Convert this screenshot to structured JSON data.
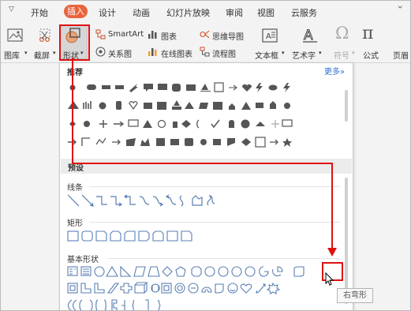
{
  "menu": {
    "tabs": [
      "开始",
      "插入",
      "设计",
      "动画",
      "幻灯片放映",
      "审阅",
      "视图",
      "云服务"
    ],
    "active_index": 1
  },
  "ribbon": {
    "gallery_label": "图库",
    "screenshot_label": "截屏",
    "shape_label": "形状",
    "smartart_label": "SmartArt",
    "chart_label": "图表",
    "mindmap_label": "思维导图",
    "relation_label": "关系图",
    "online_chart_label": "在线图表",
    "flowchart_label": "流程图",
    "textbox_label": "文本框",
    "wordart_label": "艺术字",
    "symbol_label": "符号",
    "formula_label": "公式",
    "header_footer_label": "页眉"
  },
  "panel": {
    "recommend_title": "推荐",
    "more_link": "更多»",
    "preset_title": "预设",
    "lines_title": "线条",
    "rect_title": "矩形",
    "basic_title": "基本形状"
  },
  "tooltip": {
    "text": "右弯形"
  },
  "colors": {
    "accent_active_tab": "#e9633c",
    "annotation": "#e01010",
    "link": "#2b6fd6",
    "shape_outline": "#5a7fb4"
  }
}
